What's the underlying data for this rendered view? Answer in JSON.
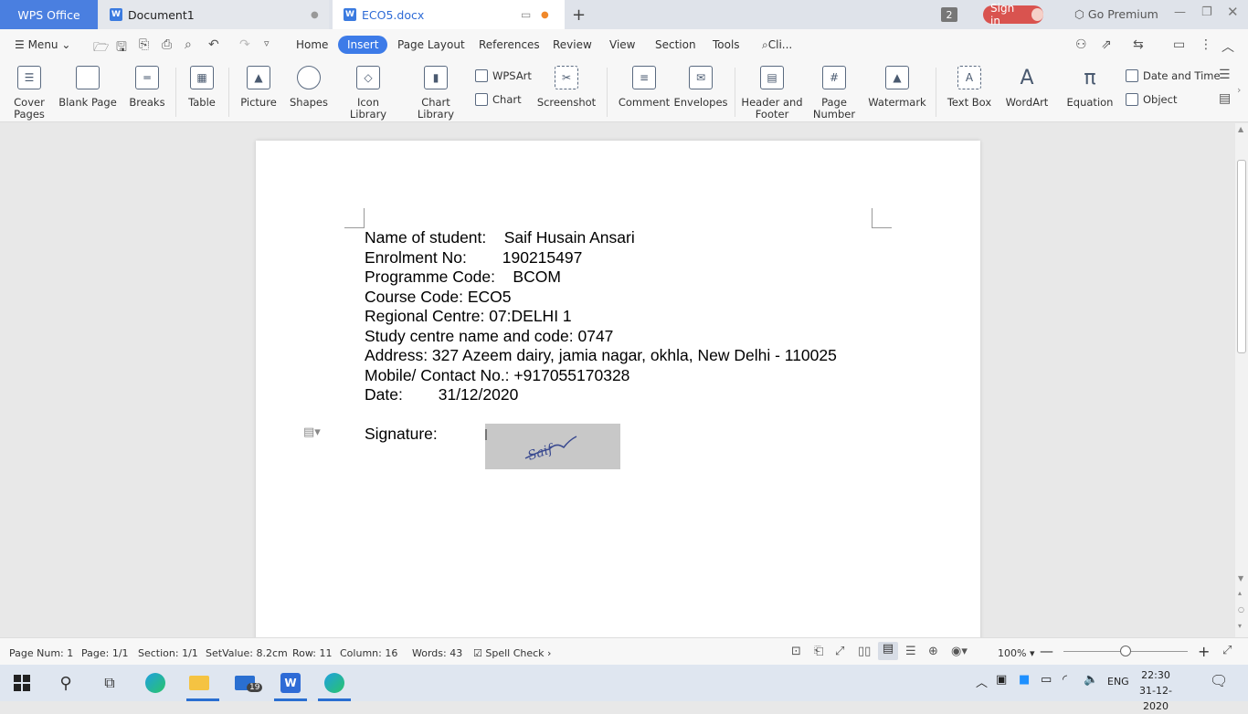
{
  "app": {
    "name": "WPS Office"
  },
  "tabs": [
    {
      "label": "Document1"
    },
    {
      "label": "ECO5.docx"
    }
  ],
  "titlebar": {
    "badge": "2",
    "sign_in": "Sign in",
    "go_premium": "Go Premium"
  },
  "menubar": {
    "menu": "Menu",
    "items": [
      "Home",
      "Insert",
      "Page Layout",
      "References",
      "Review",
      "View",
      "Section",
      "Tools"
    ],
    "search": "Cli..."
  },
  "ribbon": {
    "cover_pages": "Cover\nPages",
    "blank_page": "Blank Page",
    "breaks": "Breaks",
    "table": "Table",
    "picture": "Picture",
    "shapes": "Shapes",
    "icon_library": "Icon Library",
    "chart_library": "Chart Library",
    "wpsart": "WPSArt",
    "chart": "Chart",
    "screenshot": "Screenshot",
    "comment": "Comment",
    "envelopes": "Envelopes",
    "header_footer": "Header and\nFooter",
    "page_number": "Page\nNumber",
    "watermark": "Watermark",
    "text_box": "Text Box",
    "wordart": "WordArt",
    "equation": "Equation",
    "date_time": "Date and Time",
    "object": "Object"
  },
  "document": {
    "lines": [
      "Name of student:    Saif Husain Ansari",
      "Enrolment No:        190215497",
      "Programme Code:    BCOM",
      "Course Code: ECO5",
      "Regional Centre: 07:DELHI 1",
      "Study centre name and code: 0747",
      "Address: 327 Azeem dairy, jamia nagar, okhla, New Delhi - 110025",
      "Mobile/ Contact No.: +917055170328",
      "Date:        31/12/2020"
    ],
    "signature_label": "Signature:",
    "signature_text": "Saif"
  },
  "status": {
    "page_num": "Page Num: 1",
    "page": "Page: 1/1",
    "section": "Section: 1/1",
    "setvalue": "SetValue: 8.2cm",
    "row": "Row: 11",
    "column": "Column: 16",
    "words": "Words: 43",
    "spell": "Spell Check",
    "zoom": "100%"
  },
  "taskbar": {
    "mail_badge": "19",
    "lang": "ENG",
    "time": "22:30",
    "date": "31-12-2020"
  }
}
